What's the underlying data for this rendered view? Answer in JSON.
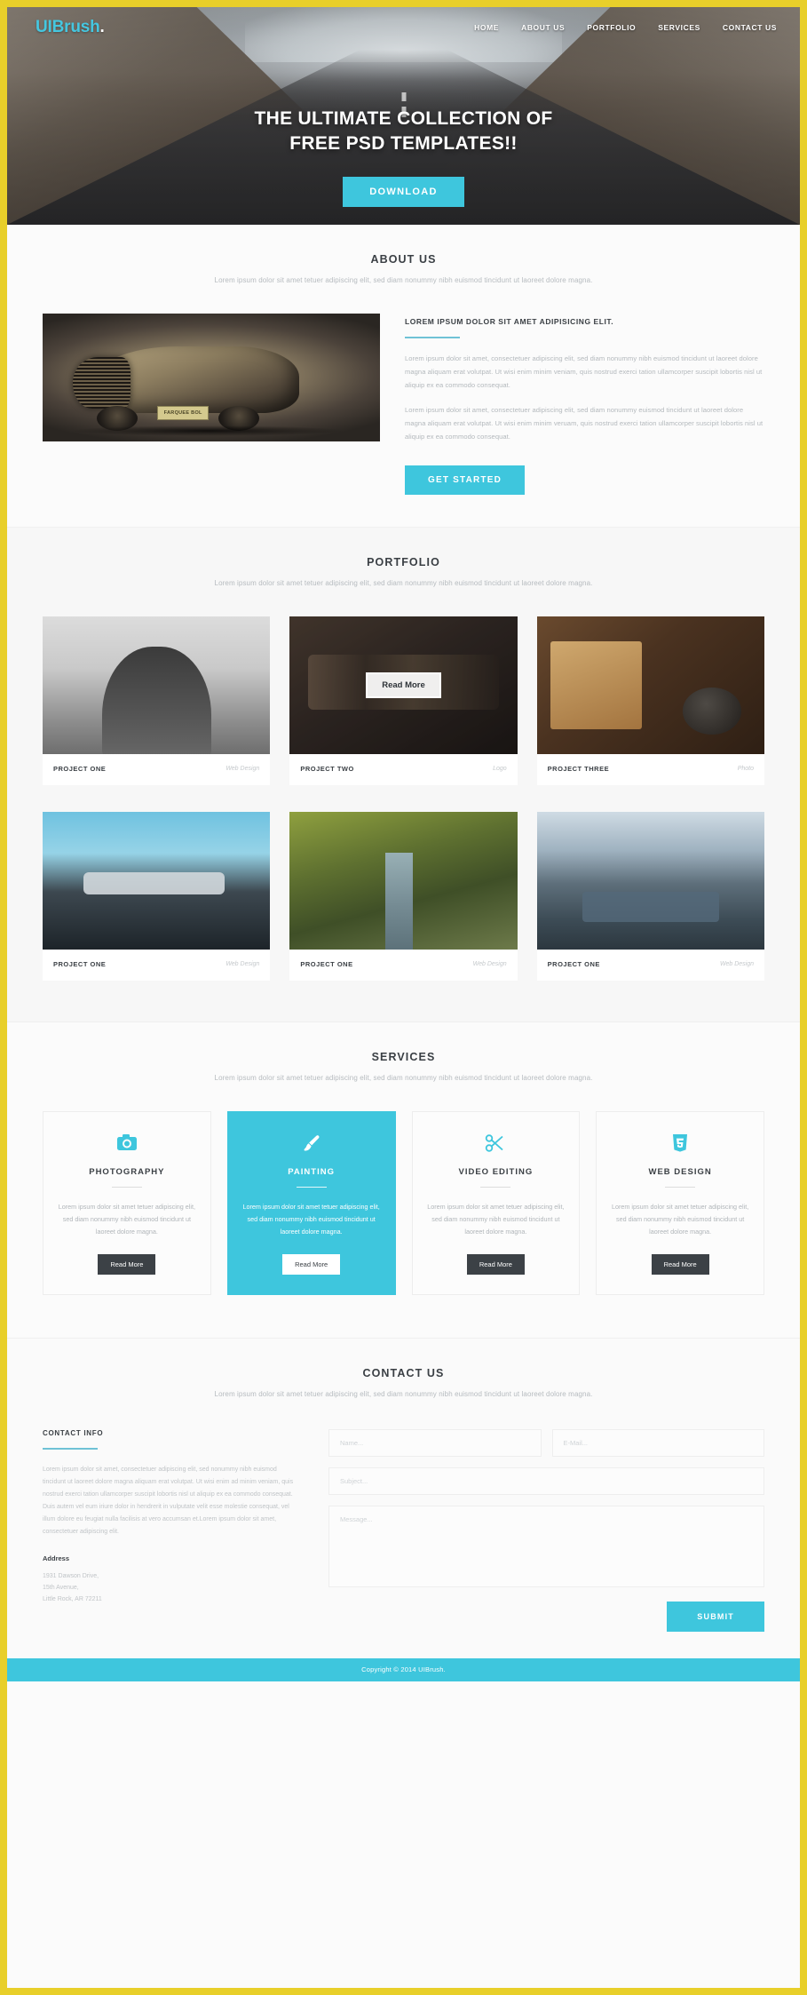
{
  "theme": {
    "accent": "#3ec6dd",
    "page_border": "#e8cf2a",
    "dark": "#3c4146",
    "muted": "#b4b9bd"
  },
  "nav": {
    "logo": "UIBrush",
    "logo_dot": ".",
    "links": [
      {
        "label": "HOME"
      },
      {
        "label": "ABOUT US"
      },
      {
        "label": "PORTFOLIO"
      },
      {
        "label": "SERVICES"
      },
      {
        "label": "CONTACT US"
      }
    ]
  },
  "hero": {
    "title_line1": "THE ULTIMATE COLLECTION OF",
    "title_line2": "FREE PSD TEMPLATES!!",
    "download_label": "DOWNLOAD"
  },
  "about": {
    "title": "ABOUT US",
    "subtitle": "Lorem ipsum dolor sit amet tetuer adipiscing elit, sed diam nonummy nibh euismod tincidunt ut laoreet dolore magna.",
    "heading": "LOREM IPSUM DOLOR SIT AMET ADIPISICING ELIT.",
    "paragraph1": "Lorem ipsum dolor sit amet, consectetuer adipiscing elit, sed diam nonummy nibh euismod tincidunt ut laoreet dolore magna aliquam erat volutpat. Ut wisi enim minim veniam, quis nostrud exerci tation ullamcorper suscipit lobortis nisl ut aliquip ex ea commodo consequat.",
    "paragraph2": "Lorem ipsum dolor sit amet, consectetuer adipiscing elit, sed diam nonummy euismod tincidunt ut laoreet dolore magna aliquam erat volutpat. Ut wisi enim minim veruam, quis nostrud exerci tation ullamcorper suscipit lobortis nisl ut aliquip ex ea commodo consequat.",
    "cta_label": "GET STARTED",
    "car_plate": "FARQUEE BOL"
  },
  "portfolio": {
    "title": "PORTFOLIO",
    "subtitle": "Lorem ipsum dolor sit amet tetuer adipiscing elit, sed diam nonummy nibh euismod tincidunt ut laoreet dolore magna.",
    "readmore_label": "Read More",
    "items": [
      {
        "name": "PROJECT ONE",
        "tag": "Web Design"
      },
      {
        "name": "PROJECT TWO",
        "tag": "Logo"
      },
      {
        "name": "PROJECT THREE",
        "tag": "Photo"
      },
      {
        "name": "PROJECT ONE",
        "tag": "Web Design"
      },
      {
        "name": "PROJECT ONE",
        "tag": "Web Design"
      },
      {
        "name": "PROJECT ONE",
        "tag": "Web Design"
      }
    ]
  },
  "services": {
    "title": "SERVICES",
    "subtitle": "Lorem ipsum dolor sit amet tetuer adipiscing elit, sed diam nonummy nibh euismod tincidunt ut laoreet dolore magna.",
    "items": [
      {
        "icon": "camera-icon",
        "name": "PHOTOGRAPHY",
        "desc": "Lorem ipsum dolor sit amet tetuer adipiscing elit, sed diam nonummy nibh euismod tincidunt ut laoreet dolore magna.",
        "button": "Read More"
      },
      {
        "icon": "paintbrush-icon",
        "name": "PAINTING",
        "desc": "Lorem ipsum dolor sit amet tetuer adipiscing elit, sed diam nonummy nibh euismod tincidunt ut laoreet dolore magna.",
        "button": "Read More"
      },
      {
        "icon": "scissors-icon",
        "name": "VIDEO EDITING",
        "desc": "Lorem ipsum dolor sit amet tetuer adipiscing elit, sed diam nonummy nibh euismod tincidunt ut laoreet dolore magna.",
        "button": "Read More"
      },
      {
        "icon": "html5-icon",
        "name": "WEB DESIGN",
        "desc": "Lorem ipsum dolor sit amet tetuer adipiscing elit, sed diam nonummy nibh euismod tincidunt ut laoreet dolore magna.",
        "button": "Read More"
      }
    ]
  },
  "contact": {
    "title": "CONTACT US",
    "subtitle": "Lorem ipsum dolor sit amet tetuer adipiscing elit, sed diam nonummy nibh euismod tincidunt ut laoreet dolore magna.",
    "info_heading": "CONTACT INFO",
    "info_paragraph": "Lorem ipsum dolor sit amet, consectetuer adipiscing elit, sed nonummy nibh euismod tincidunt ut laoreet dolore magna aliquam erat volutpat. Ut wisi enim ad minim veniam, quis nostrud exerci tation ullamcorper suscipit lobortis nisl ut aliquip ex ea commodo consequat. Duis autem vel eum iriure dolor in hendrerit in vulputate velit esse molestie consequat, vel illum dolore eu feugiat nulla facilisis at vero accumsan et.Lorem ipsum dolor sit amet, consectetuer adipiscing elit.",
    "address_heading": "Address",
    "address_line1": "1931 Dawson Drive,",
    "address_line2": "15th Avenue,",
    "address_line3": "Little Rock, AR 72211",
    "form": {
      "name_placeholder": "Name...",
      "email_placeholder": "E-Mail...",
      "subject_placeholder": "Subject...",
      "message_placeholder": "Message...",
      "name_value": "",
      "email_value": "",
      "subject_value": "",
      "message_value": "",
      "submit_label": "SUBMIT"
    }
  },
  "footer": {
    "copyright": "Copyright © 2014 UIBrush."
  }
}
